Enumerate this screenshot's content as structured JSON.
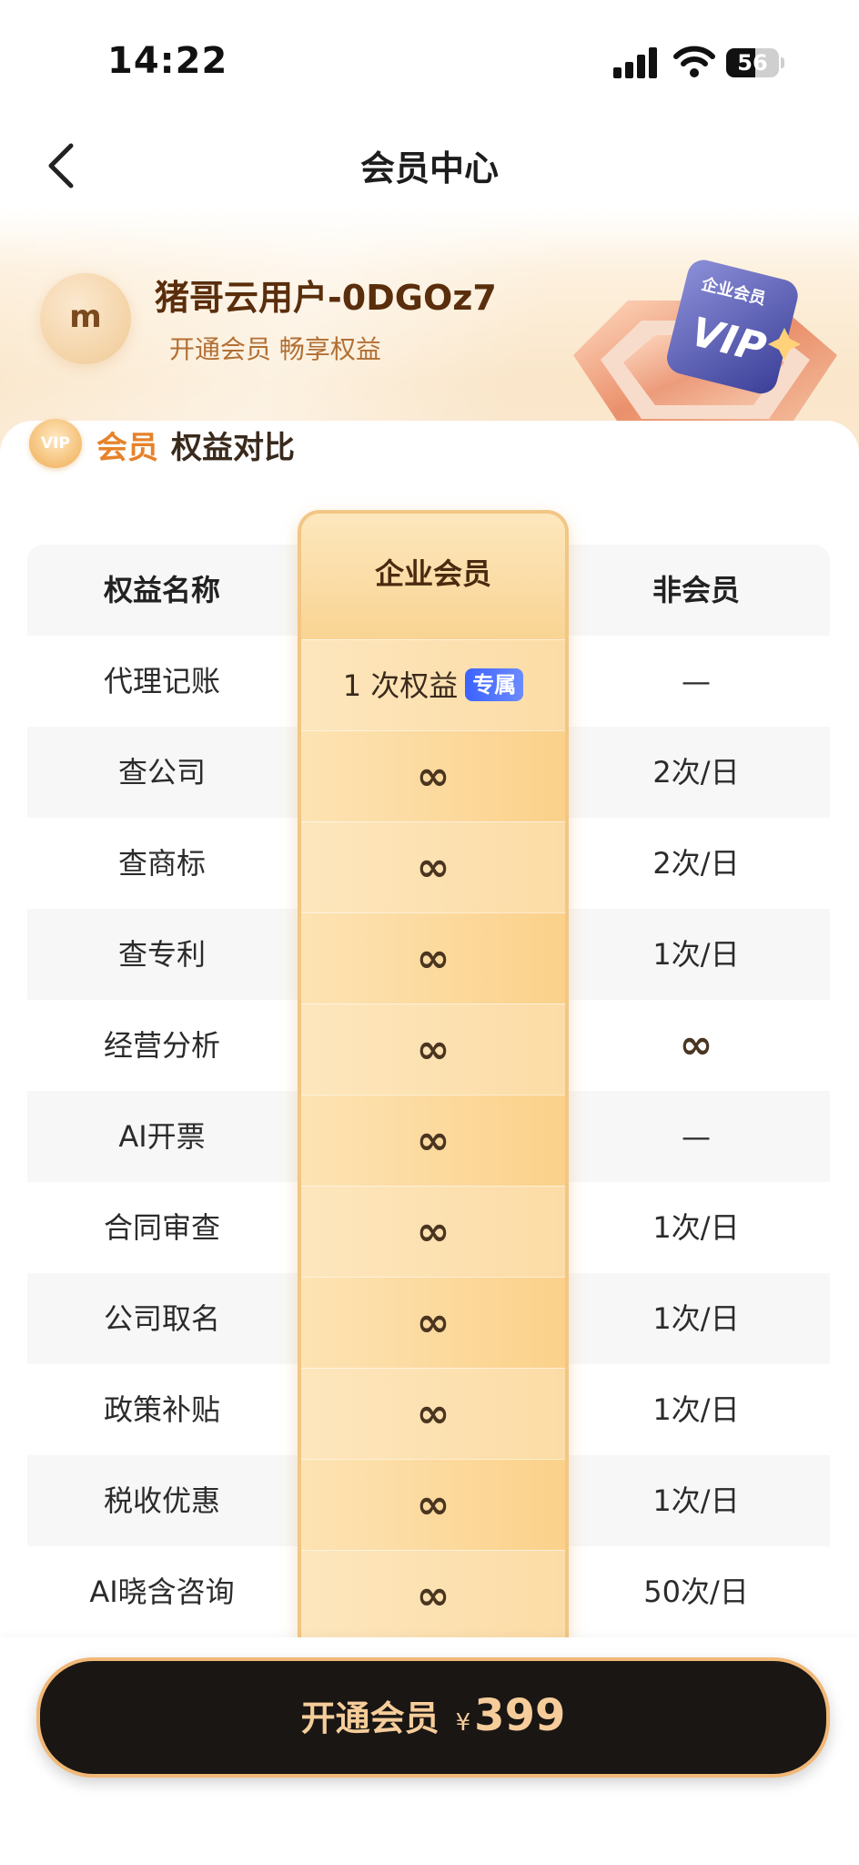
{
  "status": {
    "time": "14:22",
    "battery": "56",
    "battery_level": 0.56
  },
  "nav": {
    "title": "会员中心"
  },
  "profile": {
    "avatar_letter": "m",
    "name": "猪哥云用户-0DGOz7",
    "subtitle": "开通会员 畅享权益"
  },
  "vip_card": {
    "label": "企业会员",
    "text": "VIP"
  },
  "section": {
    "badge": "VIP",
    "title_highlight": "会员",
    "title_rest": "权益对比"
  },
  "table": {
    "headers": [
      "权益名称",
      "企业会员",
      "非会员"
    ],
    "rows": [
      {
        "name": "代理记账",
        "member": "1 次权益",
        "member_tag": "专属",
        "nonmember": "—"
      },
      {
        "name": "查公司",
        "member": "∞",
        "nonmember": "2次/日"
      },
      {
        "name": "查商标",
        "member": "∞",
        "nonmember": "2次/日"
      },
      {
        "name": "查专利",
        "member": "∞",
        "nonmember": "1次/日"
      },
      {
        "name": "经营分析",
        "member": "∞",
        "nonmember": "∞"
      },
      {
        "name": "AI开票",
        "member": "∞",
        "nonmember": "—"
      },
      {
        "name": "合同审查",
        "member": "∞",
        "nonmember": "1次/日"
      },
      {
        "name": "公司取名",
        "member": "∞",
        "nonmember": "1次/日"
      },
      {
        "name": "政策补贴",
        "member": "∞",
        "nonmember": "1次/日"
      },
      {
        "name": "税收优惠",
        "member": "∞",
        "nonmember": "1次/日"
      },
      {
        "name": "AI晓含咨询",
        "member": "∞",
        "nonmember": "50次/日"
      }
    ]
  },
  "cta": {
    "label": "开通会员",
    "currency": "¥",
    "price": "399"
  },
  "colors": {
    "accent": "#e6822a",
    "cta_bg": "#1a1614",
    "cta_text": "#f6cd9a",
    "tag_blue": "#3b62ff"
  }
}
